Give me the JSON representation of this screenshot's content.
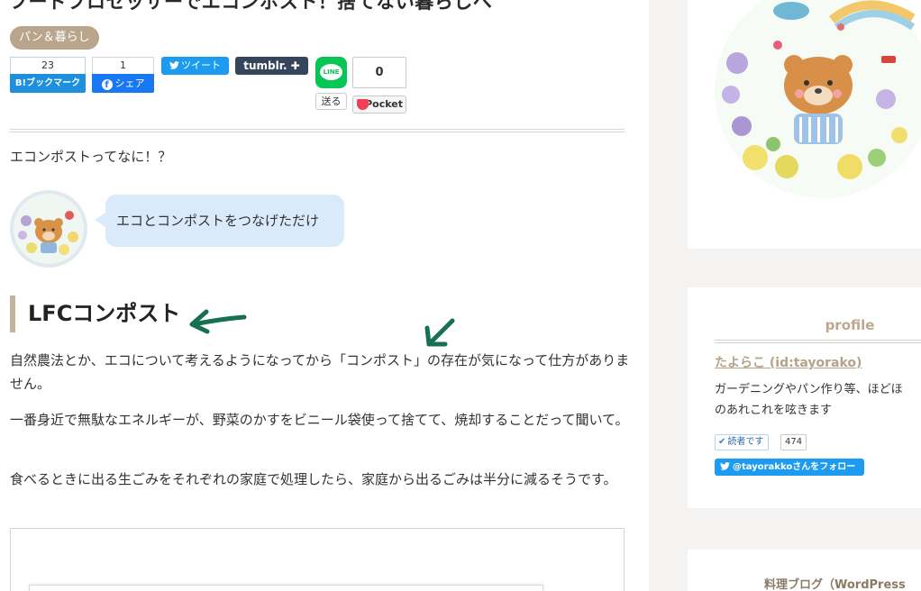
{
  "article": {
    "title": "フードプロセッサーでエコンポスト！捨てない暮らしへ",
    "category": "パン＆暮らし"
  },
  "share": {
    "hatena": {
      "count": "23",
      "label": "B!ブックマーク"
    },
    "facebook": {
      "count": "1",
      "icon": "f",
      "label": "シェア"
    },
    "tweet_label": "ツイート",
    "tumblr_label": "tumblr. ✚",
    "line": {
      "icon_text": "LINE",
      "send_label": "送る"
    },
    "pocket": {
      "count": "0",
      "label": "Pocket"
    }
  },
  "body": {
    "intro": "エコンポストってなに！？",
    "speech": "エコとコンポストをつなげただけ",
    "heading": "LFCコンポスト",
    "para1": "自然農法とか、エコについて考えるようになってから「コンポスト」の存在が気になって仕方がありません。",
    "para2": "一番身近で無駄なエネルギーが、野菜のかすをビニール袋使って捨てて、焼却することだって聞いて。",
    "para3": "食べるときに出る生ごみをそれぞれの家庭で処理したら、家庭から出るごみは半分に減るそうです。"
  },
  "sidebar": {
    "profile_title": "profile",
    "user_name": "たよらこ (id:tayorako)",
    "description_line1": "ガーデニングやパン作り等、ほどほ",
    "description_line2": "のあれこれを呟きます",
    "reader_label": "読者です",
    "reader_count": "474",
    "follow_label": "@tayorakkoさんをフォロー",
    "next_section_title": "料理ブログ（WordPress"
  },
  "colors": {
    "accent": "#b8a58c",
    "arrow": "#167052",
    "speech_bg": "#d9ebfb",
    "sidebar_bg": "#f4f3f1"
  }
}
